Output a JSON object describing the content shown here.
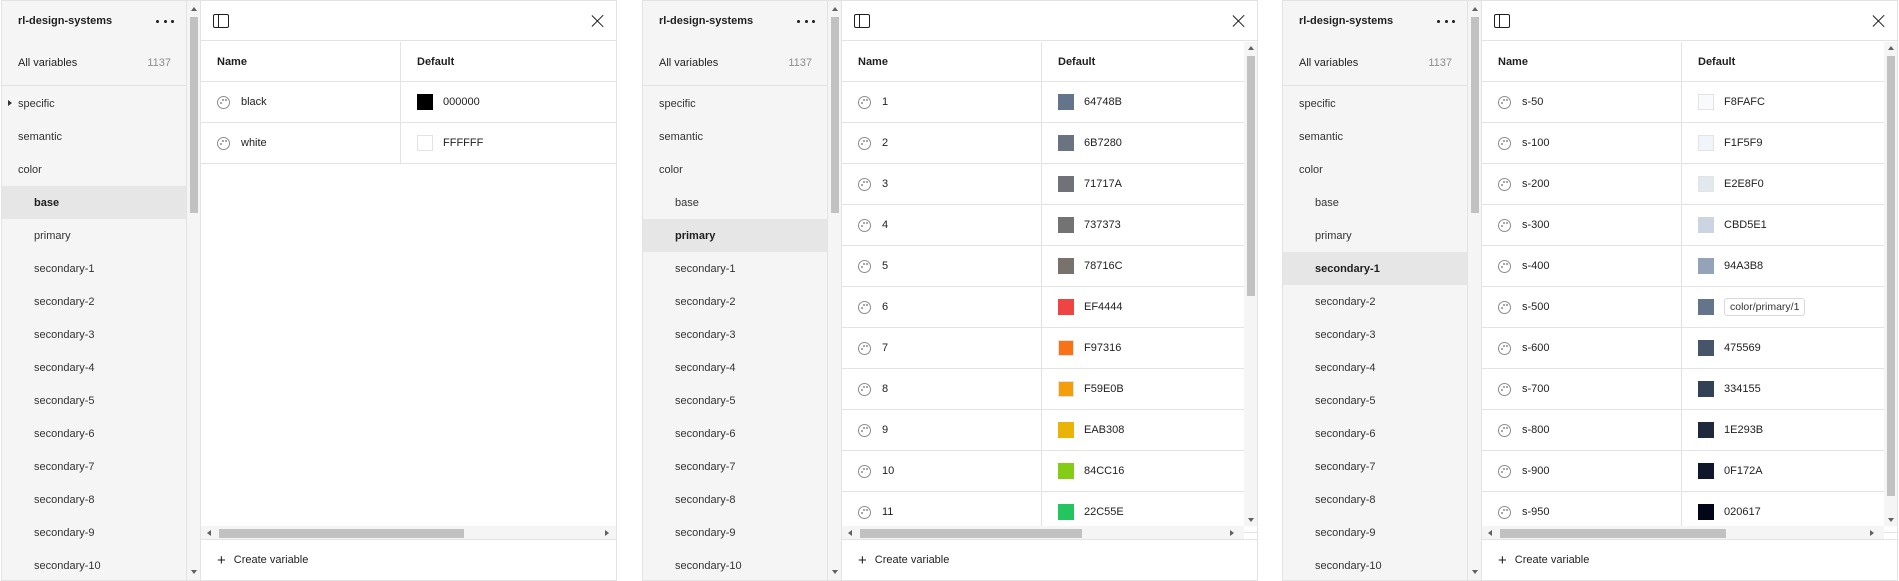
{
  "panels": [
    {
      "title": "rl-design-systems",
      "all_label": "All variables",
      "all_count": "1137",
      "groups": [
        {
          "label": "specific",
          "level": 0,
          "caret": true
        },
        {
          "label": "semantic",
          "level": 0
        },
        {
          "label": "color",
          "level": 0
        },
        {
          "label": "base",
          "level": 1,
          "selected": true
        },
        {
          "label": "primary",
          "level": 1
        },
        {
          "label": "secondary-1",
          "level": 1
        },
        {
          "label": "secondary-2",
          "level": 1
        },
        {
          "label": "secondary-3",
          "level": 1
        },
        {
          "label": "secondary-4",
          "level": 1
        },
        {
          "label": "secondary-5",
          "level": 1
        },
        {
          "label": "secondary-6",
          "level": 1
        },
        {
          "label": "secondary-7",
          "level": 1
        },
        {
          "label": "secondary-8",
          "level": 1
        },
        {
          "label": "secondary-9",
          "level": 1
        },
        {
          "label": "secondary-10",
          "level": 1
        }
      ],
      "columns": {
        "name": "Name",
        "default": "Default"
      },
      "rows": [
        {
          "name": "black",
          "value": "000000",
          "color": "#000000"
        },
        {
          "name": "white",
          "value": "FFFFFF",
          "color": "#FFFFFF"
        }
      ],
      "create_label": "Create variable",
      "main_vscroll": false
    },
    {
      "title": "rl-design-systems",
      "all_label": "All variables",
      "all_count": "1137",
      "groups": [
        {
          "label": "specific",
          "level": 0
        },
        {
          "label": "semantic",
          "level": 0
        },
        {
          "label": "color",
          "level": 0
        },
        {
          "label": "base",
          "level": 1
        },
        {
          "label": "primary",
          "level": 1,
          "selected": true
        },
        {
          "label": "secondary-1",
          "level": 1
        },
        {
          "label": "secondary-2",
          "level": 1
        },
        {
          "label": "secondary-3",
          "level": 1
        },
        {
          "label": "secondary-4",
          "level": 1
        },
        {
          "label": "secondary-5",
          "level": 1
        },
        {
          "label": "secondary-6",
          "level": 1
        },
        {
          "label": "secondary-7",
          "level": 1
        },
        {
          "label": "secondary-8",
          "level": 1
        },
        {
          "label": "secondary-9",
          "level": 1
        },
        {
          "label": "secondary-10",
          "level": 1
        }
      ],
      "columns": {
        "name": "Name",
        "default": "Default"
      },
      "rows": [
        {
          "name": "1",
          "value": "64748B",
          "color": "#64748B"
        },
        {
          "name": "2",
          "value": "6B7280",
          "color": "#6B7280"
        },
        {
          "name": "3",
          "value": "71717A",
          "color": "#71717A"
        },
        {
          "name": "4",
          "value": "737373",
          "color": "#737373"
        },
        {
          "name": "5",
          "value": "78716C",
          "color": "#78716C"
        },
        {
          "name": "6",
          "value": "EF4444",
          "color": "#EF4444"
        },
        {
          "name": "7",
          "value": "F97316",
          "color": "#F97316"
        },
        {
          "name": "8",
          "value": "F59E0B",
          "color": "#F59E0B"
        },
        {
          "name": "9",
          "value": "EAB308",
          "color": "#EAB308"
        },
        {
          "name": "10",
          "value": "84CC16",
          "color": "#84CC16"
        },
        {
          "name": "11",
          "value": "22C55E",
          "color": "#22C55E"
        }
      ],
      "create_label": "Create variable",
      "main_vscroll": true
    },
    {
      "title": "rl-design-systems",
      "all_label": "All variables",
      "all_count": "1137",
      "groups": [
        {
          "label": "specific",
          "level": 0
        },
        {
          "label": "semantic",
          "level": 0
        },
        {
          "label": "color",
          "level": 0
        },
        {
          "label": "base",
          "level": 1
        },
        {
          "label": "primary",
          "level": 1
        },
        {
          "label": "secondary-1",
          "level": 1,
          "selected": true
        },
        {
          "label": "secondary-2",
          "level": 1
        },
        {
          "label": "secondary-3",
          "level": 1
        },
        {
          "label": "secondary-4",
          "level": 1
        },
        {
          "label": "secondary-5",
          "level": 1
        },
        {
          "label": "secondary-6",
          "level": 1
        },
        {
          "label": "secondary-7",
          "level": 1
        },
        {
          "label": "secondary-8",
          "level": 1
        },
        {
          "label": "secondary-9",
          "level": 1
        },
        {
          "label": "secondary-10",
          "level": 1
        }
      ],
      "columns": {
        "name": "Name",
        "default": "Default"
      },
      "rows": [
        {
          "name": "s-50",
          "value": "F8FAFC",
          "color": "#F8FAFC"
        },
        {
          "name": "s-100",
          "value": "F1F5F9",
          "color": "#F1F5F9"
        },
        {
          "name": "s-200",
          "value": "E2E8F0",
          "color": "#E2E8F0"
        },
        {
          "name": "s-300",
          "value": "CBD5E1",
          "color": "#CBD5E1"
        },
        {
          "name": "s-400",
          "value": "94A3B8",
          "color": "#94A3B8"
        },
        {
          "name": "s-500",
          "value": "color/primary/1",
          "color": "#64748B",
          "alias": true
        },
        {
          "name": "s-600",
          "value": "475569",
          "color": "#475569"
        },
        {
          "name": "s-700",
          "value": "334155",
          "color": "#334155"
        },
        {
          "name": "s-800",
          "value": "1E293B",
          "color": "#1E293B"
        },
        {
          "name": "s-900",
          "value": "0F172A",
          "color": "#0F172A"
        },
        {
          "name": "s-950",
          "value": "020617",
          "color": "#020617"
        }
      ],
      "create_label": "Create variable",
      "main_vscroll": true
    }
  ]
}
